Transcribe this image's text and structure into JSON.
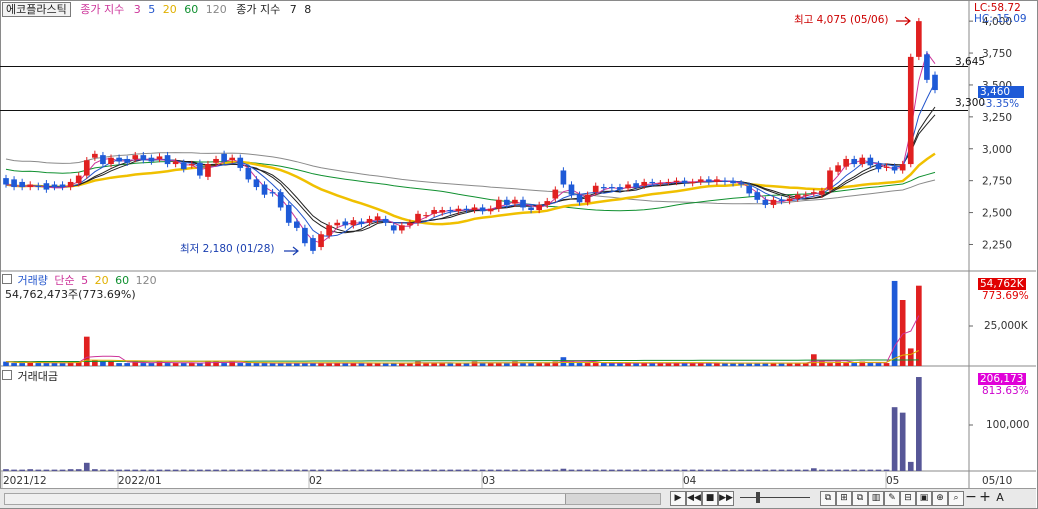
{
  "stock_name": "에코플라스틱",
  "price_legend": {
    "label": "종가 지수",
    "ma_values": [
      "3",
      "5",
      "20",
      "60",
      "120"
    ],
    "ma_colors": [
      "#cc3399",
      "#2255cc",
      "#e0b000",
      "#109030",
      "#888888"
    ],
    "label2": "종가 지수",
    "ma2_values": [
      "7",
      "8"
    ]
  },
  "volume_legend": {
    "label": "거래량",
    "ma_label": "단순",
    "ma_values": [
      "5",
      "20",
      "60",
      "120"
    ],
    "ma_colors": [
      "#cc3399",
      "#e0b000",
      "#109030",
      "#888888"
    ],
    "summary": "54,762,473주(773.69%)"
  },
  "amount_legend": {
    "label": "거래대금"
  },
  "right_panel": {
    "lc": "LC:58.72",
    "hc": "HC:-15.09",
    "current_price": "3,460",
    "current_change": "-3.35%",
    "volume_value": "54,762K",
    "volume_pct": "773.69%",
    "amount_value": "206,173",
    "amount_pct": "813.63%",
    "volume_tick": "25,000K",
    "amount_tick": "100,000"
  },
  "annotations": {
    "high": "최고 4,075 (05/06)",
    "low": "최저 2,180 (01/28)",
    "line_high": "3,645",
    "line_low": "3,300"
  },
  "date_labels": [
    "2021/12",
    "2022/01",
    "02",
    "03",
    "04",
    "05",
    "05/10"
  ],
  "chart_data": {
    "type": "candlestick",
    "title": "에코플라스틱",
    "price_axis": {
      "ticks": [
        "4,000",
        "3,750",
        "3,500",
        "3,250",
        "3,000",
        "2,750",
        "2,500",
        "2,250"
      ],
      "ylim": [
        2050,
        4150
      ]
    },
    "horizontal_lines": [
      3645,
      3300
    ],
    "x_labels": [
      "2021/12",
      "2022/01",
      "02",
      "03",
      "04",
      "05",
      "05/10"
    ],
    "candles": [
      {
        "o": 2770,
        "c": 2720
      },
      {
        "o": 2760,
        "c": 2700
      },
      {
        "o": 2740,
        "c": 2700
      },
      {
        "o": 2700,
        "c": 2720
      },
      {
        "o": 2710,
        "c": 2700
      },
      {
        "o": 2730,
        "c": 2680
      },
      {
        "o": 2720,
        "c": 2700
      },
      {
        "o": 2720,
        "c": 2700
      },
      {
        "o": 2700,
        "c": 2740
      },
      {
        "o": 2730,
        "c": 2790
      },
      {
        "o": 2790,
        "c": 2910
      },
      {
        "o": 2930,
        "c": 2960
      },
      {
        "o": 2950,
        "c": 2880
      },
      {
        "o": 2880,
        "c": 2930
      },
      {
        "o": 2930,
        "c": 2900
      },
      {
        "o": 2920,
        "c": 2890
      },
      {
        "o": 2920,
        "c": 2950
      },
      {
        "o": 2950,
        "c": 2910
      },
      {
        "o": 2930,
        "c": 2900
      },
      {
        "o": 2920,
        "c": 2940
      },
      {
        "o": 2950,
        "c": 2880
      },
      {
        "o": 2880,
        "c": 2900
      },
      {
        "o": 2890,
        "c": 2840
      },
      {
        "o": 2870,
        "c": 2880
      },
      {
        "o": 2890,
        "c": 2790
      },
      {
        "o": 2780,
        "c": 2880
      },
      {
        "o": 2890,
        "c": 2920
      },
      {
        "o": 2960,
        "c": 2900
      },
      {
        "o": 2910,
        "c": 2930
      },
      {
        "o": 2930,
        "c": 2850
      },
      {
        "o": 2850,
        "c": 2760
      },
      {
        "o": 2760,
        "c": 2700
      },
      {
        "o": 2720,
        "c": 2640
      },
      {
        "o": 2660,
        "c": 2650
      },
      {
        "o": 2660,
        "c": 2540
      },
      {
        "o": 2560,
        "c": 2420
      },
      {
        "o": 2430,
        "c": 2380
      },
      {
        "o": 2380,
        "c": 2260
      },
      {
        "o": 2300,
        "c": 2200
      },
      {
        "o": 2230,
        "c": 2330
      },
      {
        "o": 2320,
        "c": 2400
      },
      {
        "o": 2400,
        "c": 2420
      },
      {
        "o": 2430,
        "c": 2400
      },
      {
        "o": 2400,
        "c": 2440
      },
      {
        "o": 2430,
        "c": 2410
      },
      {
        "o": 2420,
        "c": 2450
      },
      {
        "o": 2440,
        "c": 2470
      },
      {
        "o": 2450,
        "c": 2420
      },
      {
        "o": 2400,
        "c": 2360
      },
      {
        "o": 2360,
        "c": 2400
      },
      {
        "o": 2400,
        "c": 2420
      },
      {
        "o": 2420,
        "c": 2490
      },
      {
        "o": 2480,
        "c": 2480
      },
      {
        "o": 2490,
        "c": 2520
      },
      {
        "o": 2500,
        "c": 2520
      },
      {
        "o": 2520,
        "c": 2510
      },
      {
        "o": 2510,
        "c": 2530
      },
      {
        "o": 2530,
        "c": 2520
      },
      {
        "o": 2520,
        "c": 2540
      },
      {
        "o": 2540,
        "c": 2510
      },
      {
        "o": 2510,
        "c": 2530
      },
      {
        "o": 2530,
        "c": 2600
      },
      {
        "o": 2600,
        "c": 2560
      },
      {
        "o": 2570,
        "c": 2600
      },
      {
        "o": 2600,
        "c": 2540
      },
      {
        "o": 2540,
        "c": 2520
      },
      {
        "o": 2520,
        "c": 2560
      },
      {
        "o": 2560,
        "c": 2590
      },
      {
        "o": 2610,
        "c": 2680
      },
      {
        "o": 2830,
        "c": 2720
      },
      {
        "o": 2720,
        "c": 2640
      },
      {
        "o": 2640,
        "c": 2580
      },
      {
        "o": 2580,
        "c": 2640
      },
      {
        "o": 2660,
        "c": 2710
      },
      {
        "o": 2700,
        "c": 2690
      },
      {
        "o": 2700,
        "c": 2690
      },
      {
        "o": 2700,
        "c": 2680
      },
      {
        "o": 2690,
        "c": 2720
      },
      {
        "o": 2730,
        "c": 2700
      },
      {
        "o": 2710,
        "c": 2740
      },
      {
        "o": 2740,
        "c": 2730
      },
      {
        "o": 2730,
        "c": 2730
      },
      {
        "o": 2740,
        "c": 2740
      },
      {
        "o": 2740,
        "c": 2750
      },
      {
        "o": 2750,
        "c": 2730
      },
      {
        "o": 2730,
        "c": 2740
      },
      {
        "o": 2740,
        "c": 2760
      },
      {
        "o": 2760,
        "c": 2740
      },
      {
        "o": 2740,
        "c": 2760
      },
      {
        "o": 2750,
        "c": 2740
      },
      {
        "o": 2750,
        "c": 2730
      },
      {
        "o": 2730,
        "c": 2720
      },
      {
        "o": 2710,
        "c": 2650
      },
      {
        "o": 2660,
        "c": 2600
      },
      {
        "o": 2600,
        "c": 2560
      },
      {
        "o": 2560,
        "c": 2600
      },
      {
        "o": 2600,
        "c": 2590
      },
      {
        "o": 2590,
        "c": 2610
      },
      {
        "o": 2610,
        "c": 2640
      },
      {
        "o": 2640,
        "c": 2640
      },
      {
        "o": 2650,
        "c": 2660
      },
      {
        "o": 2640,
        "c": 2670
      },
      {
        "o": 2680,
        "c": 2830
      },
      {
        "o": 2820,
        "c": 2870
      },
      {
        "o": 2860,
        "c": 2920
      },
      {
        "o": 2920,
        "c": 2880
      },
      {
        "o": 2880,
        "c": 2930
      },
      {
        "o": 2930,
        "c": 2870
      },
      {
        "o": 2880,
        "c": 2840
      },
      {
        "o": 2850,
        "c": 2860
      },
      {
        "o": 2860,
        "c": 2830
      },
      {
        "o": 2830,
        "c": 2880
      },
      {
        "o": 2880,
        "c": 3720
      },
      {
        "o": 3720,
        "c": 4000
      },
      {
        "o": 3740,
        "c": 3540
      },
      {
        "o": 3580,
        "c": 3460
      }
    ],
    "volume": [
      3,
      2,
      2,
      3,
      2,
      2,
      2,
      2,
      3,
      3,
      20,
      4,
      3,
      3,
      2,
      2,
      3,
      2,
      2,
      3,
      2,
      2,
      2,
      2,
      2,
      3,
      3,
      2,
      3,
      2,
      2,
      2,
      2,
      2,
      2,
      2,
      2,
      2,
      2,
      2,
      2,
      2,
      2,
      2,
      2,
      2,
      2,
      2,
      2,
      2,
      2,
      3,
      2,
      2,
      2,
      2,
      2,
      2,
      3,
      2,
      2,
      2,
      2,
      3,
      2,
      2,
      2,
      2,
      3,
      6,
      3,
      2,
      2,
      2,
      2,
      2,
      2,
      2,
      2,
      2,
      2,
      2,
      2,
      2,
      2,
      2,
      2,
      2,
      2,
      2,
      2,
      2,
      2,
      2,
      2,
      2,
      2,
      2,
      2,
      2,
      8,
      3,
      2,
      3,
      2,
      2,
      3,
      2,
      2,
      2,
      58,
      45,
      12,
      54.76
    ],
    "amount": [
      4,
      3,
      3,
      4,
      3,
      3,
      3,
      3,
      4,
      4,
      18,
      4,
      3,
      3,
      3,
      3,
      3,
      3,
      3,
      3,
      3,
      3,
      3,
      3,
      3,
      3,
      3,
      3,
      3,
      3,
      3,
      3,
      3,
      3,
      3,
      3,
      3,
      3,
      3,
      3,
      3,
      3,
      3,
      3,
      3,
      3,
      3,
      3,
      3,
      3,
      3,
      3,
      3,
      3,
      3,
      3,
      3,
      3,
      3,
      3,
      3,
      3,
      3,
      3,
      3,
      3,
      3,
      3,
      3,
      5,
      3,
      3,
      3,
      3,
      3,
      3,
      3,
      3,
      3,
      3,
      3,
      3,
      3,
      3,
      3,
      3,
      3,
      3,
      3,
      3,
      3,
      3,
      3,
      3,
      3,
      3,
      3,
      3,
      3,
      3,
      6,
      3,
      3,
      3,
      3,
      3,
      3,
      3,
      3,
      3,
      140,
      128,
      20,
      206.17
    ]
  }
}
